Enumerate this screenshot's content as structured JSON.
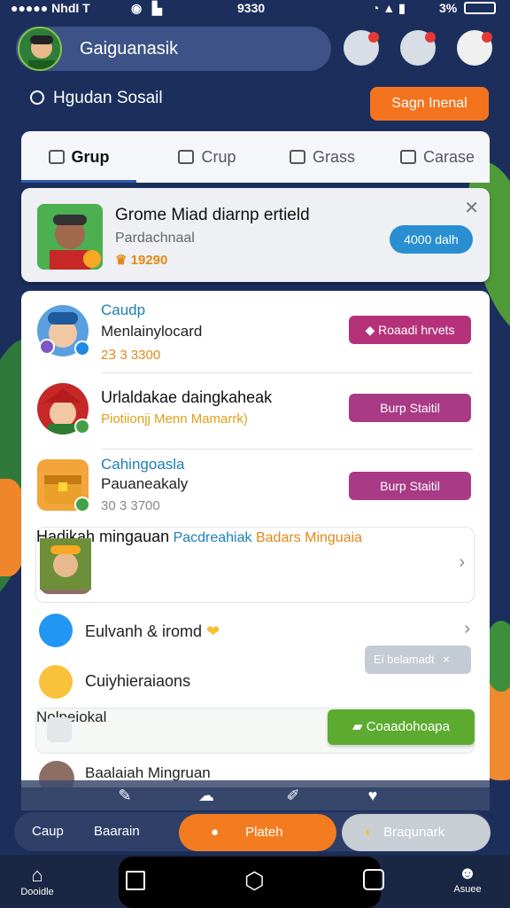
{
  "status_bar": {
    "carrier": "●●●●● NhdI T",
    "time": "9330",
    "battery": "3%"
  },
  "header": {
    "title": "Gaiguanasik"
  },
  "search": {
    "label": "Hgudan Sosail",
    "action_button": "Sagn Inenal"
  },
  "tabs": [
    {
      "label": "Grup",
      "active": true
    },
    {
      "label": "Crup"
    },
    {
      "label": "Grass"
    },
    {
      "label": "Carase"
    }
  ],
  "featured": {
    "name": "Grome Miad diarnp ertield",
    "subtitle": "Pardachnaal",
    "points": "19290",
    "pill_label": "4000 dalh"
  },
  "list": [
    {
      "title": "Caudp",
      "subtitle": "Menlainylocard",
      "meta": "2Ɜ 3 3300",
      "button": "Roaadi hrvets"
    },
    {
      "title": "Urlaldakae daingkaheak",
      "subtitle": "Piotiionjj Menn Mamarrk)",
      "button": "Burp Staitil"
    },
    {
      "title": "Cahingoasla",
      "subtitle": "Pauaneakaly",
      "meta": "30 3 3700",
      "button": "Burp Staitil"
    },
    {
      "title": "Hadikah mingauan",
      "subtitle": "Pacdreahiak",
      "meta": "Badars Minguaia"
    },
    {
      "title": "Eulvanh & iromd"
    },
    {
      "title": "Cuiyhieraiaons"
    },
    {
      "title": "Nolpeiokal"
    },
    {
      "title": "Baalaiah Mingruan"
    }
  ],
  "tooltip": {
    "label": "Ei belamadt"
  },
  "green_button": {
    "label": "Coaadohoapa"
  },
  "bottom_tabs": {
    "tab1": "Caup",
    "tab2": "Baarain",
    "tab3": "Plateh",
    "tab4": "Braqunark"
  },
  "nav": {
    "home_label": "Dooidle",
    "profile_label": "Asuee"
  },
  "colors": {
    "accent_orange": "#f47c20",
    "accent_blue": "#2a8fd0",
    "brand_purple": "#b5327a",
    "green": "#5cab30"
  }
}
